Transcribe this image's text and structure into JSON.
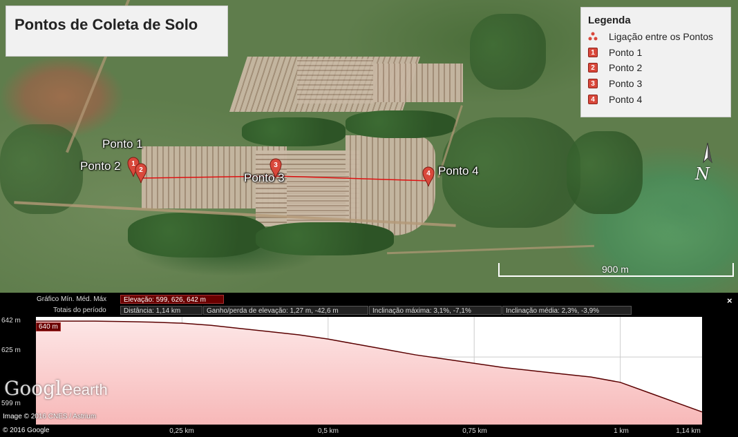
{
  "map": {
    "title": "Pontos de Coleta de Solo",
    "legend": {
      "title": "Legenda",
      "items": [
        {
          "icon": "route-icon",
          "label": "Ligação entre os Pontos"
        },
        {
          "icon": "marker-1-icon",
          "number": "1",
          "label": "Ponto 1"
        },
        {
          "icon": "marker-2-icon",
          "number": "2",
          "label": "Ponto 2"
        },
        {
          "icon": "marker-3-icon",
          "number": "3",
          "label": "Ponto 3"
        },
        {
          "icon": "marker-4-icon",
          "number": "4",
          "label": "Ponto 4"
        }
      ]
    },
    "points": [
      {
        "number": "1",
        "label": "Ponto 1"
      },
      {
        "number": "2",
        "label": "Ponto 2"
      },
      {
        "number": "3",
        "label": "Ponto 3"
      },
      {
        "number": "4",
        "label": "Ponto 4"
      }
    ],
    "north_label": "N",
    "scale_label": "900 m",
    "route_color": "#e01010",
    "marker_color": "#d9483b"
  },
  "profile": {
    "header": {
      "graph_label": "Gráfico  Mín. Méd. Máx",
      "elevation": "Elevação: 599, 626, 642 m",
      "totals_label": "Totais do período",
      "distance": "Distância: 1,14 km",
      "gain_loss": "Ganho/perda de elevação: 1,27 m, -42,6 m",
      "max_slope": "Inclinação máxima: 3,1%, -7,1%",
      "avg_slope": "Inclinação média: 2,3%, -3,9%"
    },
    "close_label": "×",
    "hover_value": "640 m",
    "y_ticks": [
      "642 m",
      "625 m",
      "599 m"
    ],
    "x_ticks": [
      "0,25 km",
      "0,5 km",
      "0,75 km",
      "1 km",
      "1,14 km"
    ],
    "fill_color": "#f7b8b8",
    "line_color": "#5a0000"
  },
  "chart_data": {
    "type": "area",
    "title": "",
    "xlabel": "",
    "ylabel": "",
    "x": [
      0,
      0.05,
      0.1,
      0.15,
      0.2,
      0.25,
      0.3,
      0.35,
      0.4,
      0.45,
      0.5,
      0.55,
      0.6,
      0.65,
      0.7,
      0.75,
      0.8,
      0.85,
      0.9,
      0.95,
      1.0,
      1.05,
      1.1,
      1.14
    ],
    "values": [
      642,
      642,
      642,
      641.8,
      641.5,
      641,
      640,
      638.5,
      637,
      635.5,
      633.5,
      631,
      628.5,
      626,
      624,
      622,
      620,
      618.5,
      617,
      615.5,
      613,
      608,
      603,
      599
    ],
    "xlim": [
      0,
      1.14
    ],
    "ylim": [
      593,
      644
    ],
    "grid": true
  },
  "attribution": {
    "logo_google": "Google",
    "logo_earth": "earth",
    "image_credit": "Image © 2016 CNES / Astrium",
    "copyright": "© 2016 Google"
  }
}
